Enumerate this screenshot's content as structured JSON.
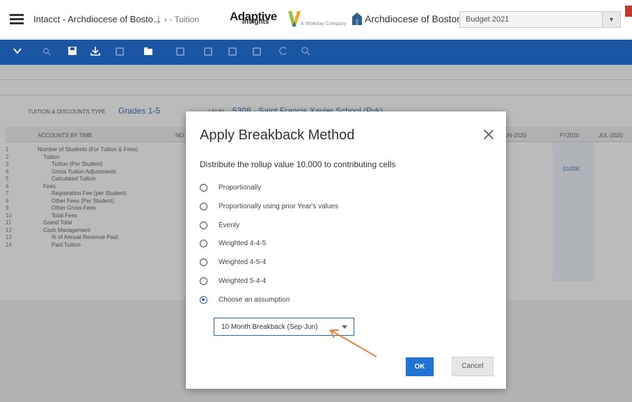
{
  "header": {
    "app_title": "Intacct - Archdiocese of Bosto...",
    "separator": "|",
    "sheet_title": "› - Tuition",
    "logo_main": "Adaptive",
    "logo_sub": "insights",
    "logo_tagline": "A Workday Company",
    "org_name": "Archdiocese of Boston",
    "version": "Budget 2021",
    "version_caret": "▼"
  },
  "filters": {
    "dimension_label": "TUITION & DISCOUNTS TYPE",
    "dimension_value": "Grades 1-5",
    "level_label": "LEVEL",
    "level_value": "5308 · Saint Francis Xavier School (Pvk)"
  },
  "grid": {
    "header_label": "ACCOUNTS BY TIME",
    "header_col_partial": "NO",
    "columns": [
      "JUN-2020",
      "FY2020",
      "JUL-2020"
    ],
    "fy_value": "10,000",
    "rows": [
      {
        "num": "1",
        "label": "Number of Students (For Tuition & Fees)"
      },
      {
        "num": "2",
        "label": "Tuition"
      },
      {
        "num": "3",
        "label": "Tuition (Per Student)"
      },
      {
        "num": "4",
        "label": "Gross Tuition Adjustments"
      },
      {
        "num": "5",
        "label": "Calculated Tuition"
      },
      {
        "num": "6",
        "label": "Fees"
      },
      {
        "num": "7",
        "label": "Registration Fee (per Student)"
      },
      {
        "num": "8",
        "label": "Other Fees (Per Student)"
      },
      {
        "num": "9",
        "label": "Other Gross Fees"
      },
      {
        "num": "10",
        "label": "Total Fees"
      },
      {
        "num": "11",
        "label": "Grand Total"
      },
      {
        "num": "12",
        "label": "Cash Management"
      },
      {
        "num": "13",
        "label": "% of Annual Revenue Paid"
      },
      {
        "num": "14",
        "label": "Paid Tuition"
      }
    ]
  },
  "dialog": {
    "title": "Apply Breakback Method",
    "description": "Distribute the rollup value 10,000 to contributing cells",
    "options": [
      {
        "label": "Proportionally"
      },
      {
        "label": "Proportionally using prior Year's values"
      },
      {
        "label": "Evenly"
      },
      {
        "label": "Weighted 4-4-5"
      },
      {
        "label": "Weighted 4-5-4"
      },
      {
        "label": "Weighted 5-4-4"
      },
      {
        "label": "Choose an assumption"
      }
    ],
    "selected_option": "Choose an assumption",
    "assumption_value": "10 Month Breakback (Sep-Jun)",
    "ok_label": "OK",
    "cancel_label": "Cancel"
  },
  "colors": {
    "toolbar": "#1a56a3",
    "accent": "#2b63ae",
    "ok_button": "#1f72d6",
    "annotation_arrow": "#e8833a"
  }
}
